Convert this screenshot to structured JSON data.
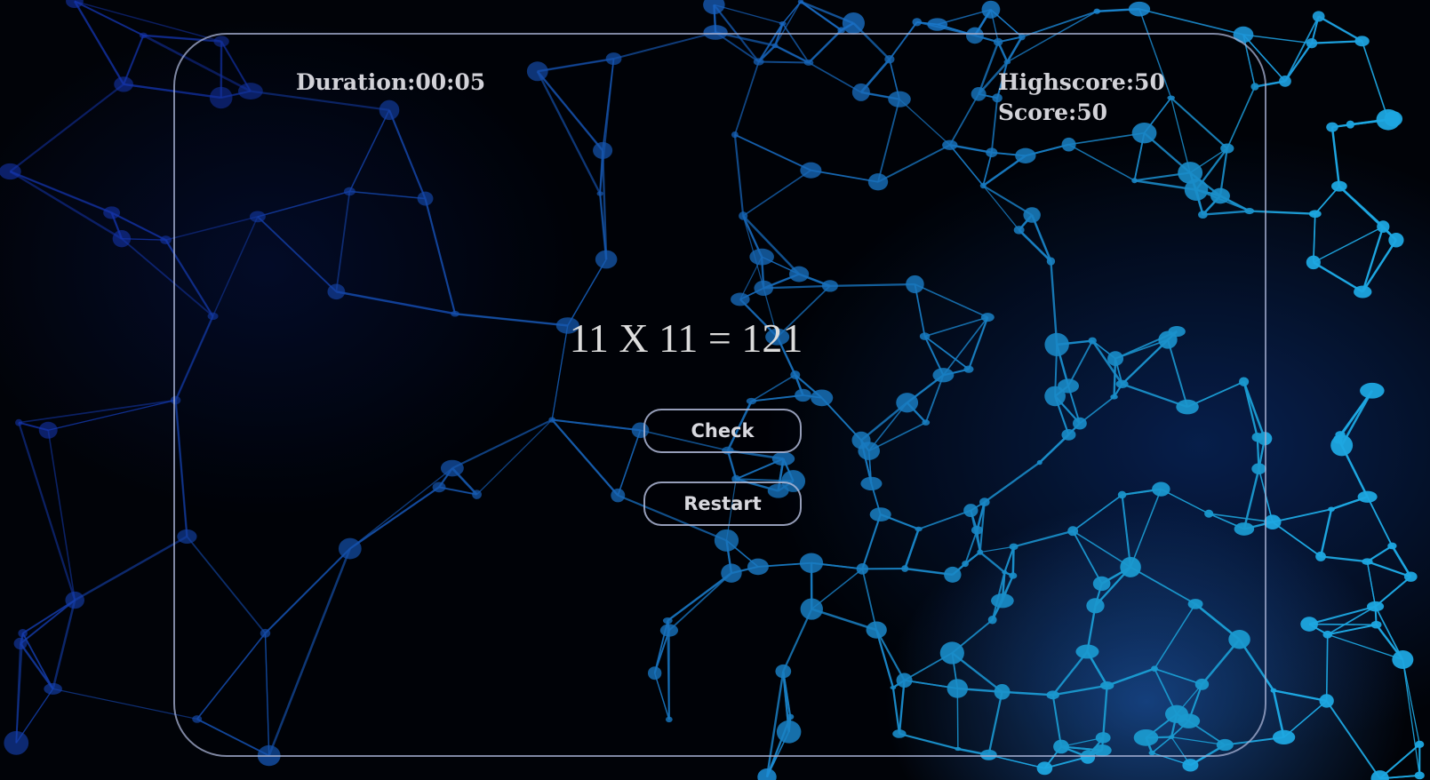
{
  "game": {
    "duration_text": "Duration:00:05",
    "highscore_text": "Highscore:50",
    "score_text": "Score:50",
    "question_text": "11 X 11 = 121"
  },
  "buttons": {
    "check_label": "Check",
    "restart_label": "Restart"
  },
  "colors": {
    "background": "#010308",
    "network_dark": "#1433a8",
    "network_light": "#1ea6e0",
    "panel_border": "#aab4d7",
    "text": "#d2d2d8"
  }
}
